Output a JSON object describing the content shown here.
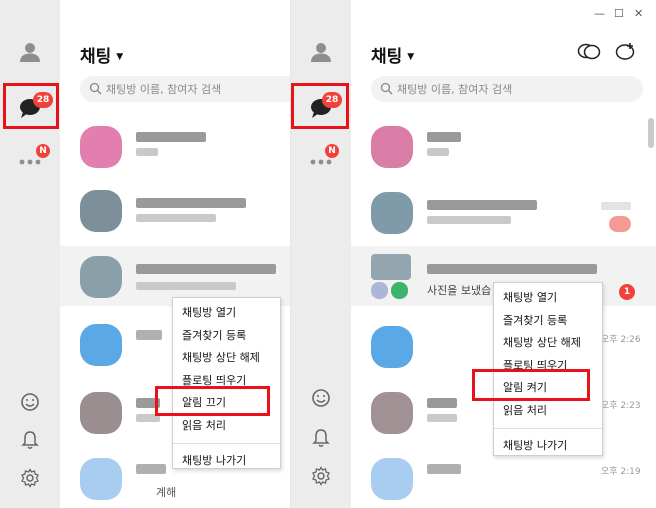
{
  "left": {
    "title": "채팅",
    "search_placeholder": "채팅방 이름, 참여자 검색",
    "chat_badge": "28",
    "more_badge": "N",
    "bottom_row_snippet": "계해",
    "context_menu": [
      {
        "label": "채팅방 열기"
      },
      {
        "label": "즐겨찾기 등록"
      },
      {
        "label": "채팅방 상단 해제"
      },
      {
        "label": "플로팅 띄우기"
      },
      {
        "label": "알림 끄기"
      },
      {
        "label": "읽음 처리"
      },
      {
        "label": "채팅방 나가기"
      }
    ]
  },
  "right": {
    "title": "채팅",
    "search_placeholder": "채팅방 이름, 참여자 검색",
    "chat_badge": "28",
    "more_badge": "N",
    "selected_row_preview": "사진을 보냈습",
    "selected_row_unread": "1",
    "times": [
      "오후 2:26",
      "오후 2:23",
      "오후 2:19"
    ],
    "context_menu": [
      {
        "label": "채팅방 열기"
      },
      {
        "label": "즐겨찾기 등록"
      },
      {
        "label": "채팅방 상단 해제"
      },
      {
        "label": "플로팅 띄우기"
      },
      {
        "label": "알림 켜기"
      },
      {
        "label": "읽음 처리"
      },
      {
        "label": "채팅방 나가기"
      }
    ]
  },
  "colors": {
    "highlight": "#e8121a",
    "badge": "#f0423a",
    "rail": "#ececec"
  }
}
